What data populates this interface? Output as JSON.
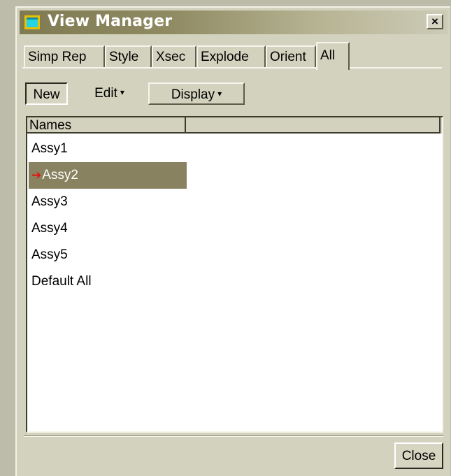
{
  "window": {
    "title": "View Manager",
    "close_glyph": "×",
    "icon": "window-icon"
  },
  "tabs": [
    {
      "label": "Simp Rep",
      "active": false
    },
    {
      "label": "Style",
      "active": false
    },
    {
      "label": "Xsec",
      "active": false
    },
    {
      "label": "Explode",
      "active": false
    },
    {
      "label": "Orient",
      "active": false
    },
    {
      "label": "All",
      "active": true
    }
  ],
  "toolbar": {
    "new_label": "New",
    "edit_label": "Edit",
    "display_label": "Display",
    "caret_glyph": "▾"
  },
  "list": {
    "columns": [
      "Names",
      ""
    ],
    "rows": [
      {
        "name": "Assy1",
        "selected": false,
        "active_marker": false
      },
      {
        "name": "Assy2",
        "selected": true,
        "active_marker": true
      },
      {
        "name": "Assy3",
        "selected": false,
        "active_marker": false
      },
      {
        "name": "Assy4",
        "selected": false,
        "active_marker": false
      },
      {
        "name": "Assy5",
        "selected": false,
        "active_marker": false
      },
      {
        "name": "Default All",
        "selected": false,
        "active_marker": false
      }
    ],
    "active_marker_glyph": "➔"
  },
  "footer": {
    "close_label": "Close"
  },
  "colors": {
    "titlebar": "#7f7a52",
    "selection": "#888260",
    "active_arrow": "#e5120f",
    "dialog_bg": "#d3d2be"
  }
}
